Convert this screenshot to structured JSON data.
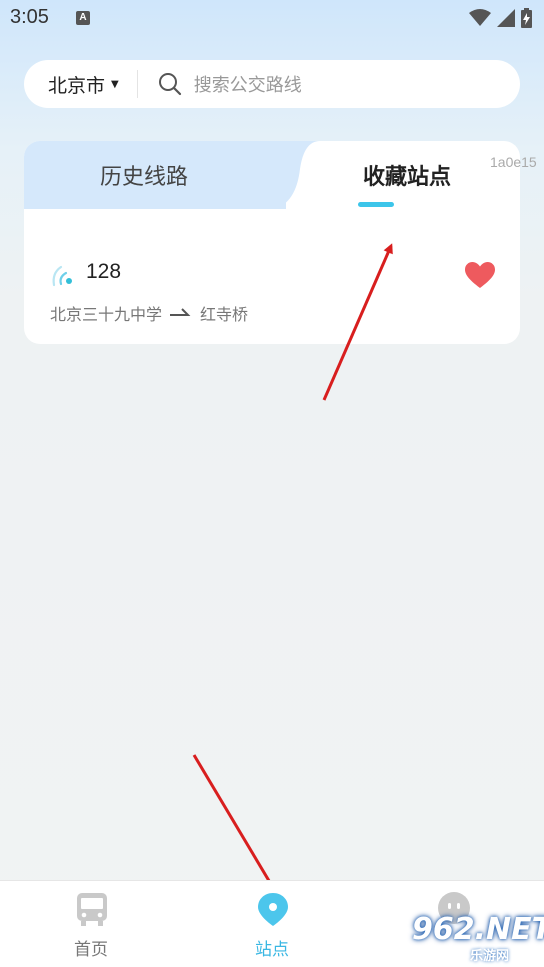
{
  "status_bar": {
    "time": "3:05",
    "notification_icon_label": "A",
    "icons": [
      "wifi-icon",
      "signal-icon",
      "battery-charging-icon"
    ]
  },
  "search": {
    "city": "北京市",
    "placeholder": "搜索公交路线"
  },
  "tabs": [
    {
      "label": "历史线路",
      "active": false
    },
    {
      "label": "收藏站点",
      "active": true
    }
  ],
  "debug_text": "1a0e15",
  "favorites": [
    {
      "route_number": "128",
      "from": "北京三十九中学",
      "to": "红寺桥",
      "favorited": true
    }
  ],
  "bottom_nav": [
    {
      "label": "首页",
      "icon": "bus-icon",
      "active": false
    },
    {
      "label": "站点",
      "icon": "location-pin-icon",
      "active": true
    },
    {
      "label": "",
      "icon": "profile-icon",
      "active": false
    }
  ],
  "watermark": {
    "brand": "962.NET",
    "sub": "乐游网"
  },
  "colors": {
    "accent": "#3ab7e3",
    "heart": "#ee5a5e",
    "tab_inactive_bg": "#d5e8fb",
    "arrow": "#d81e1e"
  }
}
